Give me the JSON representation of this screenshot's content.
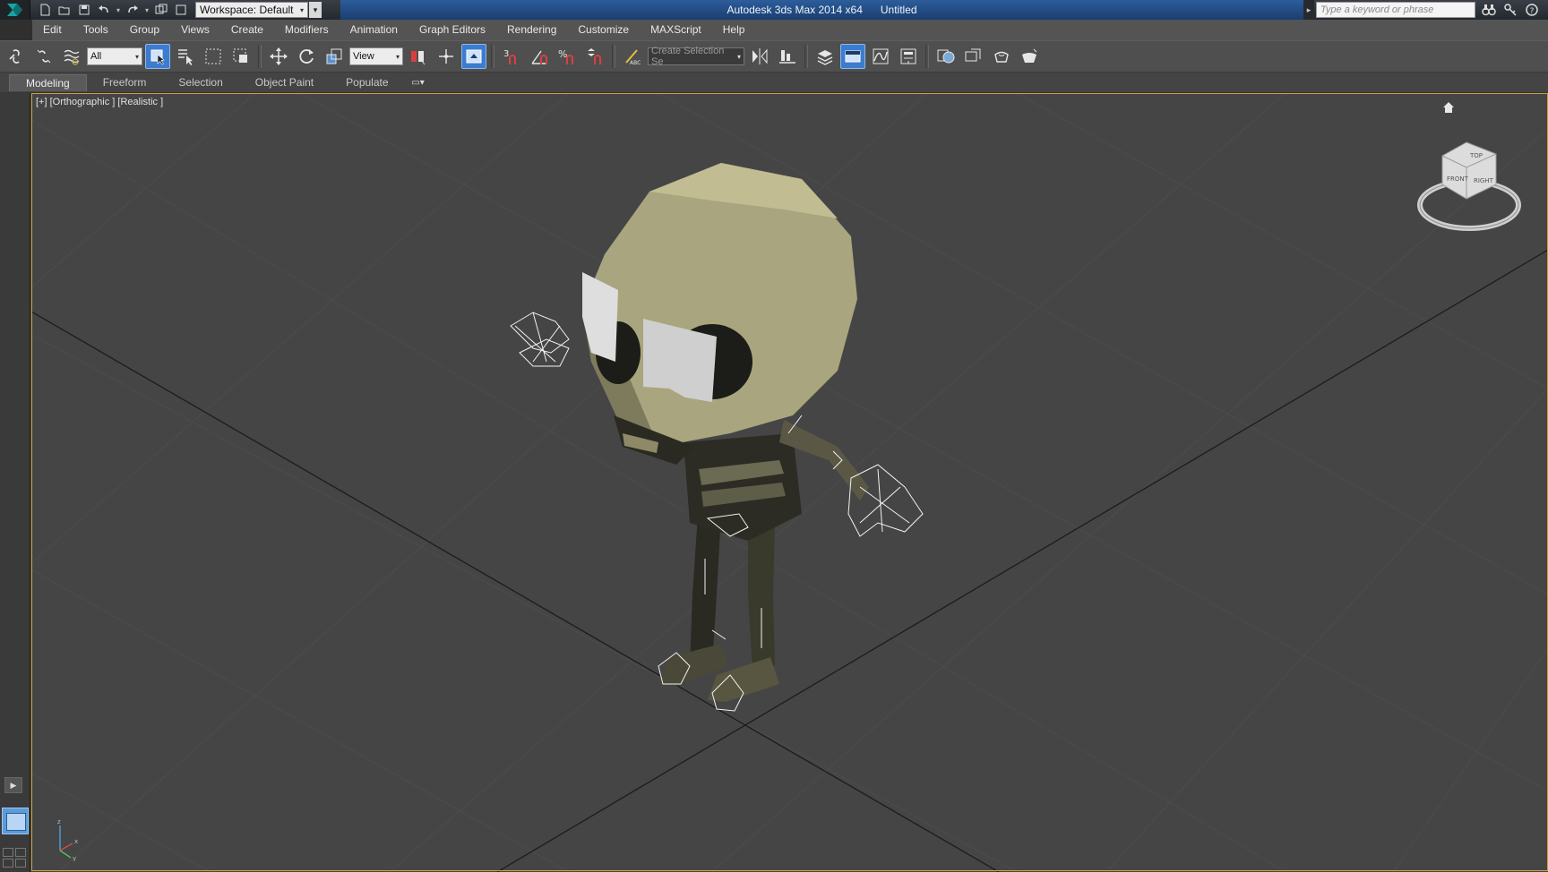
{
  "title_bar": {
    "workspace_label": "Workspace: Default",
    "app_name": "Autodesk 3ds Max  2014 x64",
    "document_name": "Untitled",
    "search_placeholder": "Type a keyword or phrase"
  },
  "menu": {
    "items": [
      "Edit",
      "Tools",
      "Group",
      "Views",
      "Create",
      "Modifiers",
      "Animation",
      "Graph Editors",
      "Rendering",
      "Customize",
      "MAXScript",
      "Help"
    ]
  },
  "toolbar": {
    "selection_filter": "All",
    "reference_coord": "View",
    "named_selection_placeholder": "Create Selection Se",
    "snap_label": "3",
    "percent_snap_label": "%"
  },
  "ribbon": {
    "tabs": [
      "Modeling",
      "Freeform",
      "Selection",
      "Object Paint",
      "Populate"
    ],
    "active_tab": "Modeling"
  },
  "viewport": {
    "label": "[+] [Orthographic ] [Realistic ]",
    "viewcube_faces": {
      "top": "TOP",
      "front": "FRONT",
      "right": "RIGHT"
    },
    "axis_labels": {
      "z": "z",
      "x": "x",
      "y": "y"
    },
    "border_color": "#c9a23c"
  },
  "colors": {
    "titlebar_accent": "#2c5d9b",
    "active_tool": "#3c7ccf",
    "viewport_bg": "#454545"
  }
}
